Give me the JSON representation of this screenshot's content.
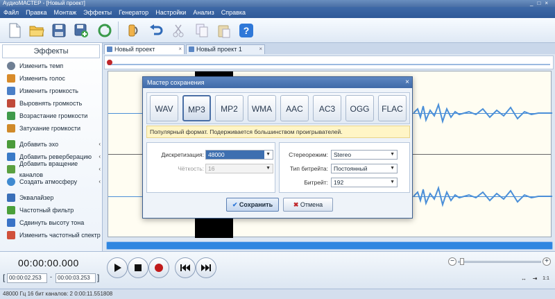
{
  "window": {
    "title": "АудиоМАСТЕР - [Новый проект]"
  },
  "menu": [
    "Файл",
    "Правка",
    "Монтаж",
    "Эффекты",
    "Генератор",
    "Настройки",
    "Анализ",
    "Справка"
  ],
  "toolbar": {
    "buttons": [
      {
        "icon": "new-file-icon"
      },
      {
        "icon": "open-folder-icon"
      },
      {
        "icon": "save-icon"
      },
      {
        "icon": "save-as-icon"
      },
      {
        "icon": "refresh-icon"
      },
      {
        "icon": "record-icon"
      },
      {
        "icon": "undo-icon"
      },
      {
        "icon": "cut-icon"
      },
      {
        "icon": "copy-icon"
      },
      {
        "icon": "paste-icon"
      },
      {
        "icon": "help-icon"
      }
    ]
  },
  "sidebar": {
    "title": "Эффекты",
    "items": [
      {
        "label": "Изменить темп",
        "icon": "tempo-icon",
        "color": "#6f7f93"
      },
      {
        "label": "Изменить голос",
        "icon": "voice-icon",
        "color": "#d88b2a"
      },
      {
        "label": "Изменить громкость",
        "icon": "volume-icon",
        "color": "#4a7fc7"
      },
      {
        "label": "Выровнять громкость",
        "icon": "level-icon",
        "color": "#c04a3a"
      },
      {
        "label": "Возрастание громкости",
        "icon": "fade-in-icon",
        "color": "#3f9a4a"
      },
      {
        "label": "Затухание громкости",
        "icon": "fade-out-icon",
        "color": "#d08a2a"
      },
      {
        "label": "Добавить эхо",
        "icon": "echo-icon",
        "color": "#4a9b3a"
      },
      {
        "label": "Добавить реверберацию",
        "icon": "reverb-icon",
        "color": "#3a7ac7"
      },
      {
        "label": "Добавить вращение каналов",
        "icon": "rotate-icon",
        "color": "#5aa040"
      },
      {
        "label": "Создать атмосферу",
        "icon": "atmosphere-icon",
        "color": "#3f8ad0"
      },
      {
        "label": "Эквалайзер",
        "icon": "equalizer-icon",
        "color": "#3a6fb8"
      },
      {
        "label": "Частотный фильтр",
        "icon": "filter-icon",
        "color": "#4aa03a"
      },
      {
        "label": "Сдвинуть высоту тона",
        "icon": "pitch-icon",
        "color": "#3a73c6"
      },
      {
        "label": "Изменить частотный спектр",
        "icon": "spectrum-icon",
        "color": "#d0503a"
      }
    ]
  },
  "tabs": [
    {
      "label": "Новый проект",
      "active": true
    },
    {
      "label": "Новый проект 1",
      "active": false
    }
  ],
  "transport": {
    "timecode": "00:00:00.000",
    "sel_start": "00:00:02.253",
    "sel_end": "00:00:03.253",
    "sel_dash": "-"
  },
  "zoom": {
    "minus": "−",
    "plus": "+",
    "fit_label": "1:1"
  },
  "status": "48000 Гц  16 бит  каналов: 2   0:00:11.551808",
  "dialog": {
    "title": "Мастер сохранения",
    "formats": [
      "WAV",
      "MP3",
      "MP2",
      "WMA",
      "AAC",
      "AC3",
      "OGG",
      "FLAC"
    ],
    "selected_format": "MP3",
    "info": "Популярный формат. Подерживается большинством проигрывателей.",
    "sample_rate_label": "Дискретизация:",
    "sample_rate_value": "48000",
    "precision_label": "Чёткость:",
    "precision_value": "16",
    "stereo_label": "Стереорежим:",
    "stereo_value": "Stereo",
    "bitrate_type_label": "Тип битрейта:",
    "bitrate_type_value": "Постоянный",
    "bitrate_label": "Битрейт:",
    "bitrate_value": "192",
    "save_label": "Сохранить",
    "cancel_label": "Отмена"
  }
}
